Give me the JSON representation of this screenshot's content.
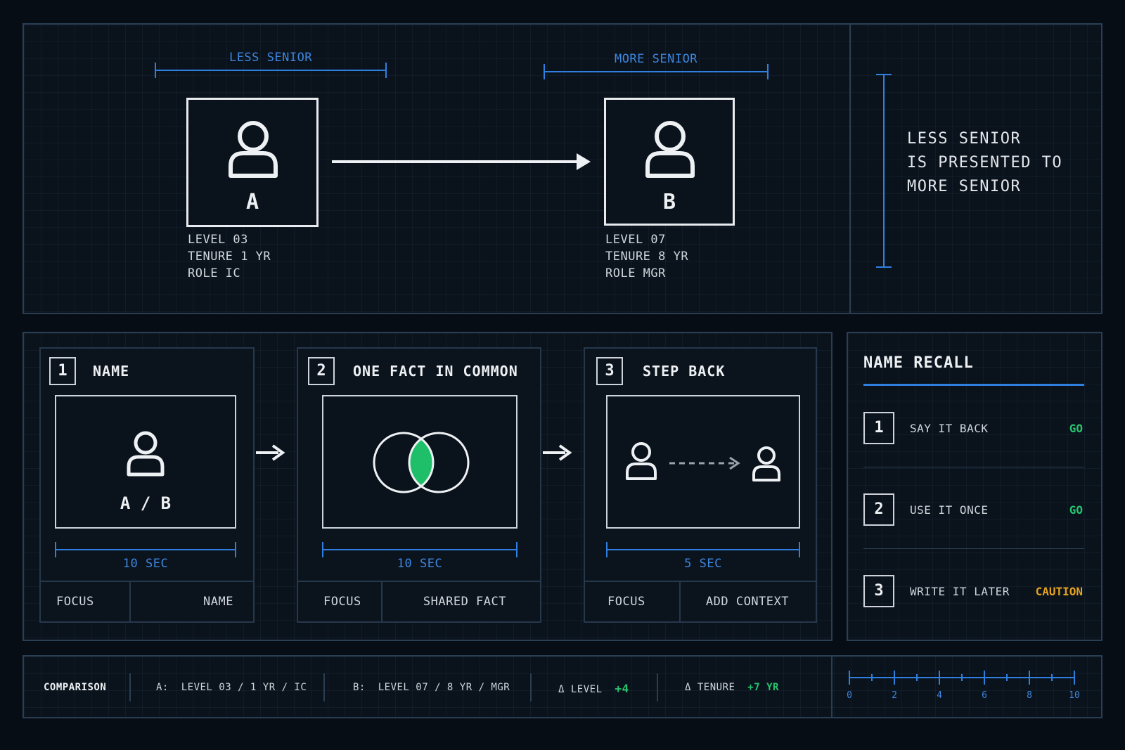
{
  "top": {
    "less_senior_label": "LESS SENIOR",
    "more_senior_label": "MORE SENIOR",
    "person_a": {
      "letter": "A",
      "level": "LEVEL 03",
      "tenure": "TENURE 1 YR",
      "role": "ROLE IC"
    },
    "person_b": {
      "letter": "B",
      "level": "LEVEL 07",
      "tenure": "TENURE 8 YR",
      "role": "ROLE MGR"
    },
    "rule_lines": [
      "LESS SENIOR",
      "IS PRESENTED TO",
      "MORE SENIOR"
    ]
  },
  "steps": [
    {
      "num": "1",
      "title": "NAME",
      "inner_text": "A / B",
      "duration": "10 SEC",
      "focus_label": "FOCUS",
      "focus_value": "NAME"
    },
    {
      "num": "2",
      "title": "ONE FACT IN COMMON",
      "duration": "10 SEC",
      "focus_label": "FOCUS",
      "focus_value": "SHARED FACT"
    },
    {
      "num": "3",
      "title": "STEP BACK",
      "duration": "5 SEC",
      "focus_label": "FOCUS",
      "focus_value": "ADD CONTEXT"
    }
  ],
  "recall": {
    "title": "NAME RECALL",
    "items": [
      {
        "num": "1",
        "label": "SAY IT BACK",
        "status": "GO"
      },
      {
        "num": "2",
        "label": "USE IT ONCE",
        "status": "GO"
      },
      {
        "num": "3",
        "label": "WRITE IT LATER",
        "status": "CAUTION"
      }
    ]
  },
  "comparison": {
    "label": "COMPARISON",
    "a_prefix": "A:",
    "a_value": "LEVEL 03 / 1 YR / IC",
    "b_prefix": "B:",
    "b_value": "LEVEL 07 / 8 YR / MGR",
    "level_label": "Δ LEVEL",
    "level_value": "+4",
    "tenure_label": "Δ TENURE",
    "tenure_value": "+7 YR"
  },
  "scale": {
    "ticks": [
      "0",
      "2",
      "4",
      "6",
      "8",
      "10"
    ]
  },
  "colors": {
    "accent": "#2f7fe0",
    "go": "#27c46e",
    "caution": "#e3a21f",
    "shared_fact": "#1fbf6a"
  }
}
